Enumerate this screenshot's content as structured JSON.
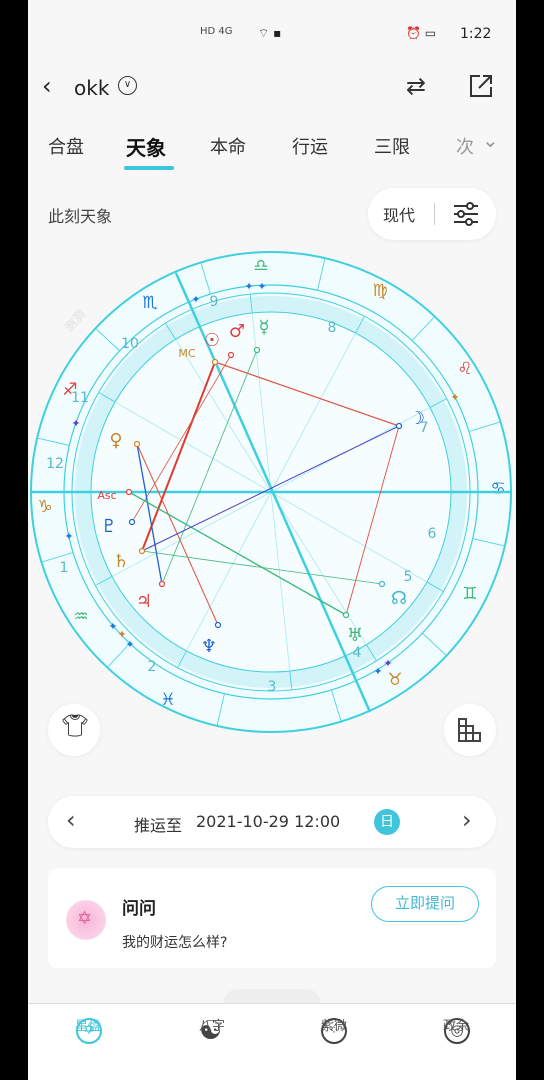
{
  "status_bar": {
    "network": "HD 4G",
    "time": "1:22"
  },
  "header": {
    "title": "okk"
  },
  "tabs": [
    {
      "label": "合盘"
    },
    {
      "label": "天象",
      "active": true
    },
    {
      "label": "本命"
    },
    {
      "label": "行运"
    },
    {
      "label": "三限"
    },
    {
      "label": "次"
    }
  ],
  "section": {
    "title": "此刻天象",
    "mode": "现代"
  },
  "chart": {
    "watermark": "测测",
    "houses": [
      "1",
      "2",
      "3",
      "4",
      "5",
      "6",
      "7",
      "8",
      "9",
      "10",
      "11",
      "12"
    ],
    "signs": [
      "♈",
      "♉",
      "♊",
      "♋",
      "♌",
      "♍",
      "♎",
      "♏",
      "♐",
      "♑",
      "♒",
      "♓"
    ],
    "labels": {
      "mc": "MC",
      "asc": "Asc"
    },
    "planets": {
      "sun": "☉",
      "moon": "☽",
      "mercury": "☿",
      "venus": "♀",
      "mars": "♂",
      "jupiter": "♃",
      "saturn": "♄",
      "uranus": "♅",
      "neptune": "♆",
      "pluto": "♇",
      "node": "☊"
    },
    "accent": "#3fd0e0"
  },
  "date_nav": {
    "label": "推运至",
    "datetime": "2021-10-29 12:00",
    "unit": "日"
  },
  "ask_card": {
    "title": "问问",
    "question": "我的财运怎么样?",
    "button": "立即提问"
  },
  "bottom_nav": [
    {
      "label": "星盘",
      "active": true
    },
    {
      "label": "八字"
    },
    {
      "label": "紫微"
    },
    {
      "label": "政余"
    }
  ]
}
